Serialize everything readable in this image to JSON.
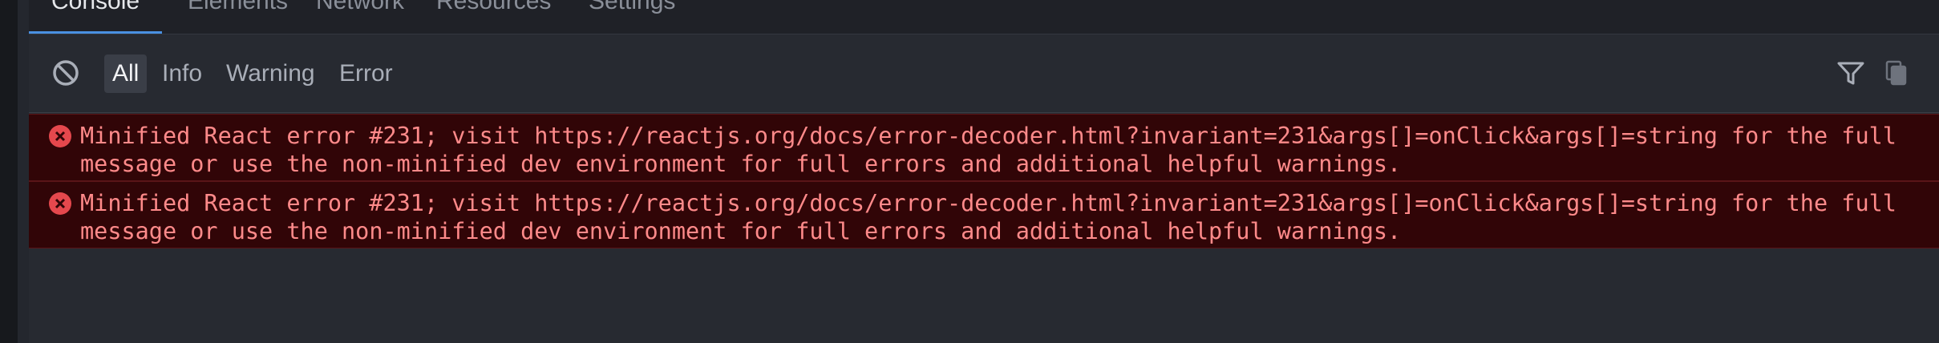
{
  "tabs": [
    {
      "label": "Console"
    },
    {
      "label": "Elements"
    },
    {
      "label": "Network"
    },
    {
      "label": "Resources"
    },
    {
      "label": "Settings"
    }
  ],
  "toolbar": {
    "clear_icon": "clear-console-icon",
    "filters": [
      {
        "label": "All",
        "active": true
      },
      {
        "label": "Info",
        "active": false
      },
      {
        "label": "Warning",
        "active": false
      },
      {
        "label": "Error",
        "active": false
      }
    ],
    "filter_icon": "funnel-icon",
    "copy_icon": "copy-icon"
  },
  "logs": [
    {
      "level": "error",
      "icon": "error-circle-x-icon",
      "message": "Minified React error #231; visit https://reactjs.org/docs/error-decoder.html?invariant=231&args[]=onClick&args[]=string for the full message or use the non-minified dev environment for full errors and additional helpful warnings."
    },
    {
      "level": "error",
      "icon": "error-circle-x-icon",
      "message": "Minified React error #231; visit https://reactjs.org/docs/error-decoder.html?invariant=231&args[]=onClick&args[]=string for the full message or use the non-minified dev environment for full errors and additional helpful warnings."
    }
  ],
  "colors": {
    "background": "#272a31",
    "error_row": "#310507",
    "error_text": "#ff8a8a",
    "error_icon": "#e5484d",
    "active_tab_underline": "#4a90e2"
  }
}
